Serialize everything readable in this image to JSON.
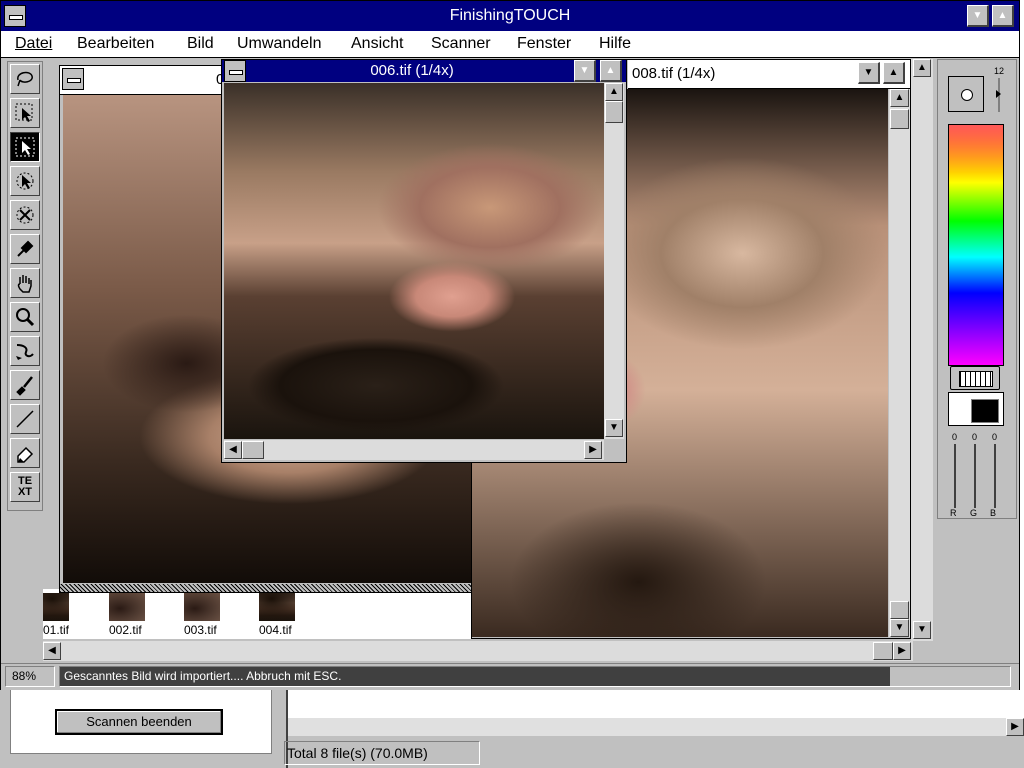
{
  "app": {
    "title": "FinishingTOUCH",
    "menu": [
      "Datei",
      "Bearbeiten",
      "Bild",
      "Umwandeln",
      "Ansicht",
      "Scanner",
      "Fenster",
      "Hilfe"
    ]
  },
  "windows": {
    "back_left": {
      "title_fragment": "0"
    },
    "mid": {
      "title": "006.tif (1/4x)"
    },
    "right": {
      "title": "008.tif (1/4x)"
    }
  },
  "thumbnails": [
    "01.tif",
    "002.tif",
    "003.tif",
    "004.tif"
  ],
  "status": {
    "zoom": "88%",
    "message": "Gescanntes Bild wird importiert.... Abbruch mit ESC."
  },
  "palette": {
    "brush_size_label": "12",
    "sliders": [
      {
        "name": "R",
        "value": "0"
      },
      {
        "name": "G",
        "value": "0"
      },
      {
        "name": "B",
        "value": "0"
      }
    ]
  },
  "tools": [
    "lasso-icon",
    "select-arrow-icon",
    "pointer-icon",
    "rotate-pointer-icon",
    "crop-icon",
    "eyedropper-icon",
    "hand-icon",
    "zoom-icon",
    "smudge-icon",
    "brush-icon",
    "line-icon",
    "eraser-icon",
    "text-icon"
  ],
  "text_tool_label": "TE XT",
  "scan_dialog": {
    "button": "Scannen beenden"
  },
  "file_manager": {
    "total": "Total 8 file(s) (70.0MB)"
  }
}
